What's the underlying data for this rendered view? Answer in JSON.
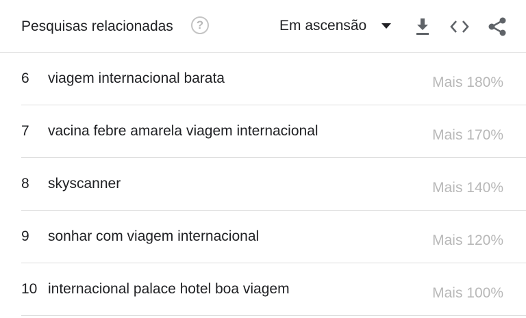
{
  "header": {
    "title": "Pesquisas relacionadas",
    "help_glyph": "?",
    "filter_selected": "Em ascensão",
    "icons": [
      "help-icon",
      "dropdown-arrow-icon",
      "download-icon",
      "embed-code-icon",
      "share-icon"
    ]
  },
  "rows": [
    {
      "rank": "6",
      "query": "viagem internacional barata",
      "value": "Mais 180%"
    },
    {
      "rank": "7",
      "query": "vacina febre amarela viagem internacional",
      "value": "Mais 170%"
    },
    {
      "rank": "8",
      "query": "skyscanner",
      "value": "Mais 140%"
    },
    {
      "rank": "9",
      "query": "sonhar com viagem internacional",
      "value": "Mais 120%"
    },
    {
      "rank": "10",
      "query": "internacional palace hotel boa viagem",
      "value": "Mais 100%"
    }
  ]
}
